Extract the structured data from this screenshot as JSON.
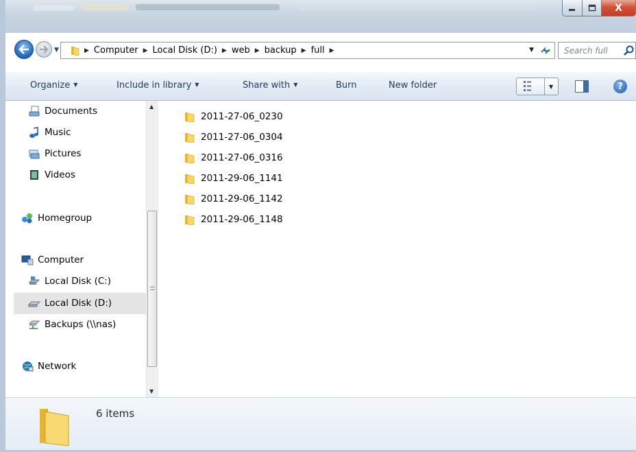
{
  "window": {
    "controls": {
      "minimize": "minimize",
      "maximize": "maximize",
      "close": "X"
    }
  },
  "address": {
    "crumbs": [
      "Computer",
      "Local Disk (D:)",
      "web",
      "backup",
      "full"
    ]
  },
  "search": {
    "placeholder": "Search full"
  },
  "toolbar": {
    "organize": "Organize",
    "include_in_library": "Include in library",
    "share_with": "Share with",
    "burn": "Burn",
    "new_folder": "New folder",
    "help": "?"
  },
  "sidebar": {
    "items": [
      {
        "label": "Documents",
        "icon": "documents-icon"
      },
      {
        "label": "Music",
        "icon": "music-icon"
      },
      {
        "label": "Pictures",
        "icon": "pictures-icon"
      },
      {
        "label": "Videos",
        "icon": "videos-icon"
      },
      {
        "label": "Homegroup",
        "icon": "homegroup-icon"
      },
      {
        "label": "Computer",
        "icon": "computer-icon"
      },
      {
        "label": "Local Disk (C:)",
        "icon": "system-drive-icon"
      },
      {
        "label": "Local Disk (D:)",
        "icon": "drive-icon",
        "selected": true
      },
      {
        "label": "Backups (\\\\nas)",
        "icon": "network-drive-icon"
      },
      {
        "label": "Network",
        "icon": "network-icon"
      }
    ]
  },
  "files": [
    {
      "name": "2011-27-06_0230",
      "icon": "folder-icon"
    },
    {
      "name": "2011-27-06_0304",
      "icon": "folder-icon"
    },
    {
      "name": "2011-27-06_0316",
      "icon": "folder-icon"
    },
    {
      "name": "2011-29-06_1141",
      "icon": "folder-icon"
    },
    {
      "name": "2011-29-06_1142",
      "icon": "folder-icon"
    },
    {
      "name": "2011-29-06_1148",
      "icon": "folder-icon"
    }
  ],
  "details": {
    "item_count": "6 items"
  },
  "colors": {
    "accent": "#1e3a5c",
    "selection": "#e5e5e5",
    "folder": "#f2c94c",
    "close": "#c23b21"
  }
}
